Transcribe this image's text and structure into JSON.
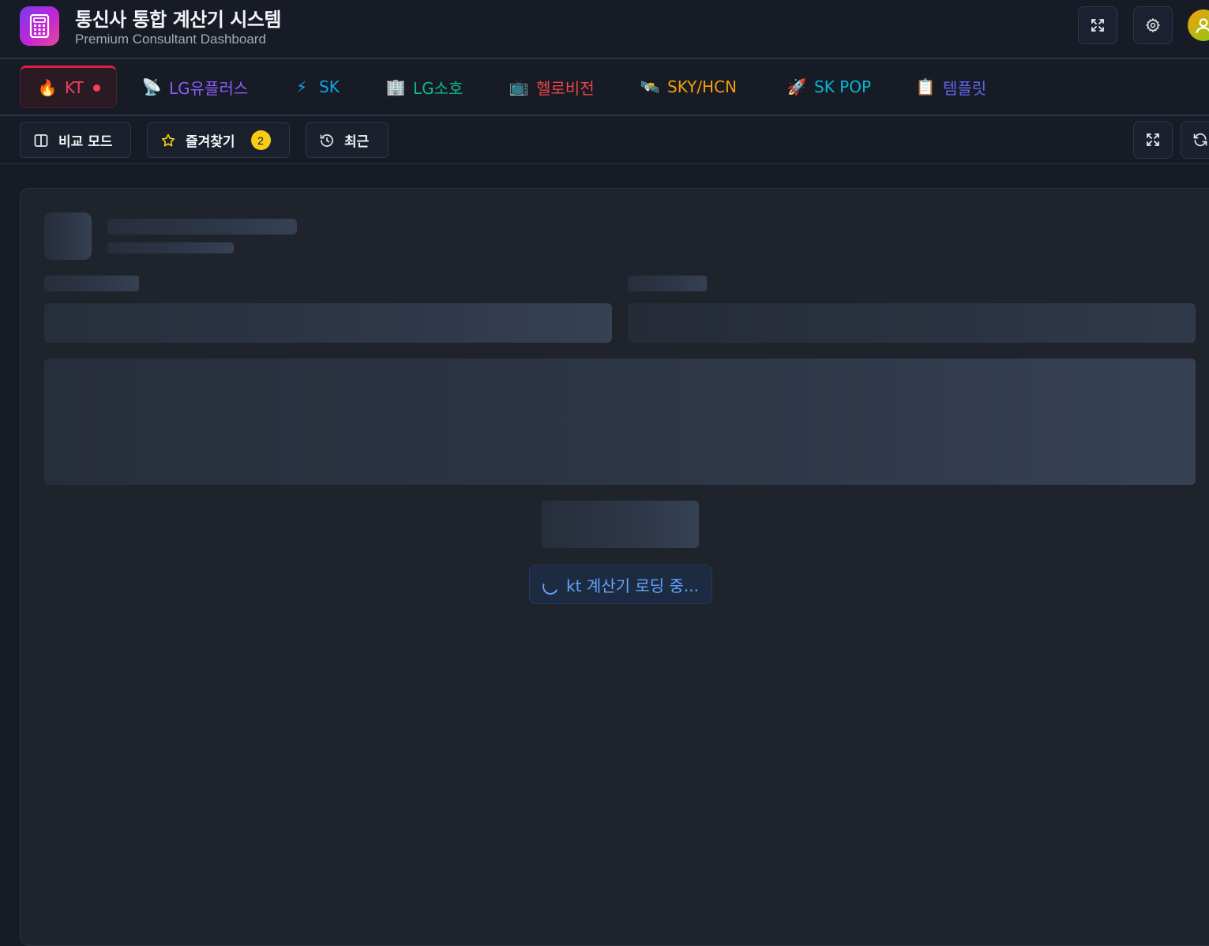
{
  "header": {
    "title": "통신사 통합 계산기 시스템",
    "subtitle": "Premium Consultant Dashboard",
    "buttons": [
      "fullscreen-icon",
      "gear-icon"
    ],
    "avatar_icon": "user-icon"
  },
  "tabs": [
    {
      "label": "KT",
      "icon": "🔥",
      "color": "#f43f5e",
      "active": true
    },
    {
      "label": "LG유플러스",
      "icon": "📡",
      "color": "#8b5cf6"
    },
    {
      "label": "SK",
      "icon": "⚡",
      "color": "#0ea5e9"
    },
    {
      "label": "LG소호",
      "icon": "🏢",
      "color": "#10b981"
    },
    {
      "label": "헬로비전",
      "icon": "📺",
      "color": "#ef4444"
    },
    {
      "label": "SKY/HCN",
      "icon": "🛰️",
      "color": "#f59e0b"
    },
    {
      "label": "SK POP",
      "icon": "🚀",
      "color": "#06b6d4"
    },
    {
      "label": "템플릿",
      "icon": "📋",
      "color": "#6366f1"
    }
  ],
  "toolbar": {
    "compare_label": "비교 모드",
    "favorites_label": "즐겨찾기",
    "favorites_count": "2",
    "recent_label": "최근"
  },
  "main": {
    "loading_text": "kt 계산기 로딩 중..."
  }
}
